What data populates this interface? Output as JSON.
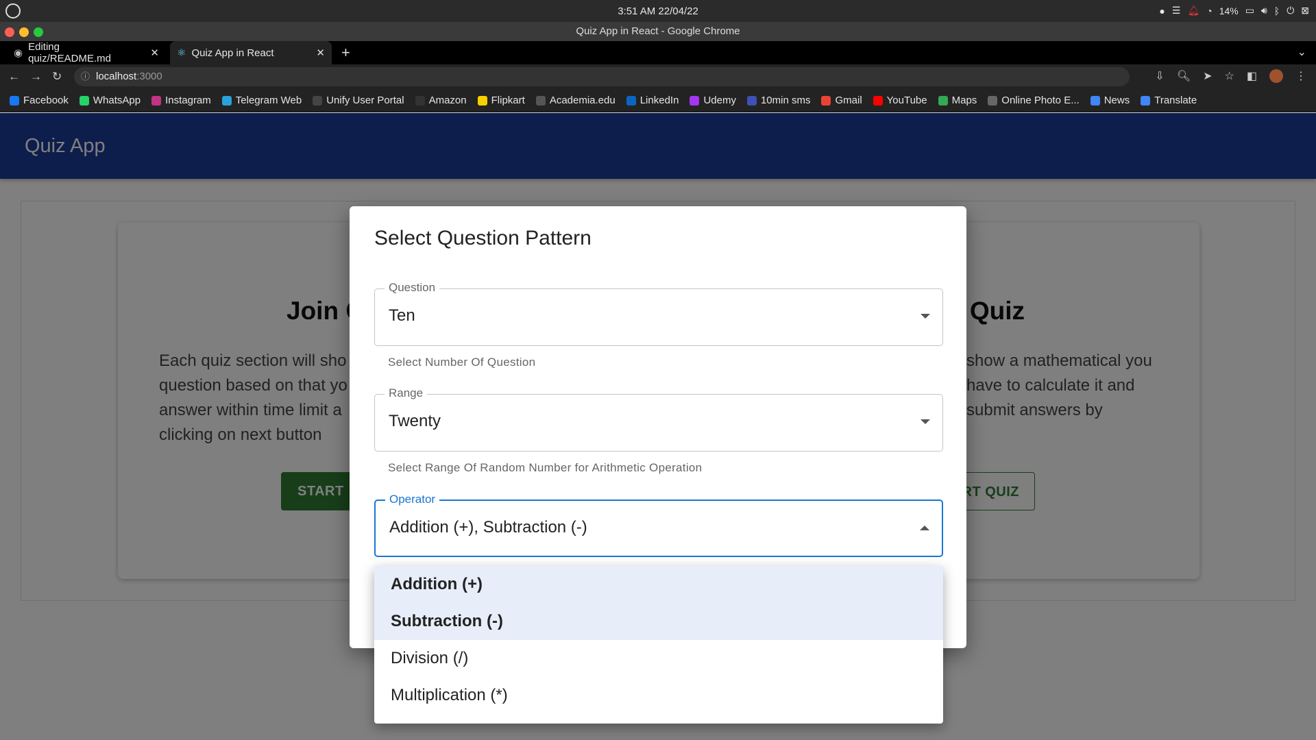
{
  "os": {
    "clock": "3:51 AM  22/04/22",
    "battery": "14%"
  },
  "window": {
    "title": "Quiz App in React - Google Chrome"
  },
  "tabs": [
    {
      "label": "Editing quiz/README.md"
    },
    {
      "label": "Quiz App in React"
    }
  ],
  "address": {
    "host": "localhost",
    "port": ":3000"
  },
  "bookmarks": [
    {
      "label": "Facebook",
      "color": "#1877f2"
    },
    {
      "label": "WhatsApp",
      "color": "#25d366"
    },
    {
      "label": "Instagram",
      "color": "#c13584"
    },
    {
      "label": "Telegram Web",
      "color": "#2aa1da"
    },
    {
      "label": "Unify User Portal",
      "color": "#444444"
    },
    {
      "label": "Amazon",
      "color": "#333333"
    },
    {
      "label": "Flipkart",
      "color": "#f7d000"
    },
    {
      "label": "Academia.edu",
      "color": "#555555"
    },
    {
      "label": "LinkedIn",
      "color": "#0a66c2"
    },
    {
      "label": "Udemy",
      "color": "#a435f0"
    },
    {
      "label": "10min sms",
      "color": "#3f51b5"
    },
    {
      "label": "Gmail",
      "color": "#ea4335"
    },
    {
      "label": "YouTube",
      "color": "#ff0000"
    },
    {
      "label": "Maps",
      "color": "#34a853"
    },
    {
      "label": "Online Photo E...",
      "color": "#666666"
    },
    {
      "label": "News",
      "color": "#4285f4"
    },
    {
      "label": "Translate",
      "color": "#4285f4"
    }
  ],
  "app": {
    "brand": "Quiz App",
    "left_card": {
      "title": "Join C",
      "body": "Each quiz section will sho question based on that yo answer within time limit a clicking on next button",
      "button": "START"
    },
    "right_card": {
      "title": "n Quiz",
      "body": "show a mathematical you have to calculate it and submit answers by",
      "button": "RT QUIZ"
    }
  },
  "dialog": {
    "title": "Select Question Pattern",
    "question": {
      "label": "Question",
      "value": "Ten",
      "helper": "Select Number Of Question"
    },
    "range": {
      "label": "Range",
      "value": "Twenty",
      "helper": "Select Range Of Random Number for Arithmetic Operation"
    },
    "operator": {
      "label": "Operator",
      "value": "Addition (+), Subtraction (-)"
    }
  },
  "menu": {
    "options": [
      {
        "label": "Addition (+)",
        "selected": true
      },
      {
        "label": "Subtraction (-)",
        "selected": true
      },
      {
        "label": "Division (/)",
        "selected": false
      },
      {
        "label": "Multiplication (*)",
        "selected": false
      }
    ]
  }
}
